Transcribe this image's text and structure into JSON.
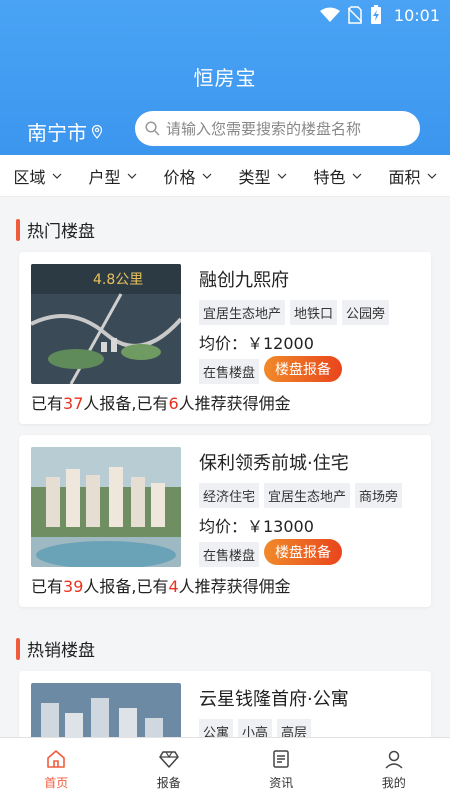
{
  "status_bar": {
    "time": "10:01"
  },
  "header": {
    "title": "恒房宝",
    "city": "南宁市",
    "search_placeholder": "请输入您需要搜索的楼盘名称"
  },
  "filters": [
    "区域",
    "户型",
    "价格",
    "类型",
    "特色",
    "面积"
  ],
  "sections": {
    "hot": "热门楼盘",
    "selling": "热销楼盘"
  },
  "hot_listings": [
    {
      "name": "融创九熙府",
      "tags": [
        "宜居生态地产",
        "地铁口",
        "公园旁"
      ],
      "price": "均价：￥12000",
      "sale_status": "在售楼盘",
      "button": "楼盘报备",
      "stats": {
        "p1": "已有",
        "reported": "37",
        "p2": "人报备,已有",
        "recommended": "6",
        "p3": "人推荐获得佣金"
      },
      "image_text": "4.8公里"
    },
    {
      "name": "保利领秀前城·住宅",
      "tags": [
        "经济住宅",
        "宜居生态地产",
        "商场旁"
      ],
      "price": "均价：￥13000",
      "sale_status": "在售楼盘",
      "button": "楼盘报备",
      "stats": {
        "p1": "已有",
        "reported": "39",
        "p2": "人报备,已有",
        "recommended": "4",
        "p3": "人推荐获得佣金"
      }
    }
  ],
  "selling_listings": [
    {
      "name": "云星钱隆首府·公寓",
      "tags": [
        "公寓",
        "小高",
        "高层"
      ]
    }
  ],
  "tabbar": [
    {
      "label": "首页",
      "icon": "home-icon",
      "active": true
    },
    {
      "label": "报备",
      "icon": "diamond-icon",
      "active": false
    },
    {
      "label": "资讯",
      "icon": "news-icon",
      "active": false
    },
    {
      "label": "我的",
      "icon": "user-icon",
      "active": false
    }
  ],
  "colors": {
    "primary": "#3c96ee",
    "accent": "#f15b3d",
    "highlight": "#e8321f"
  }
}
